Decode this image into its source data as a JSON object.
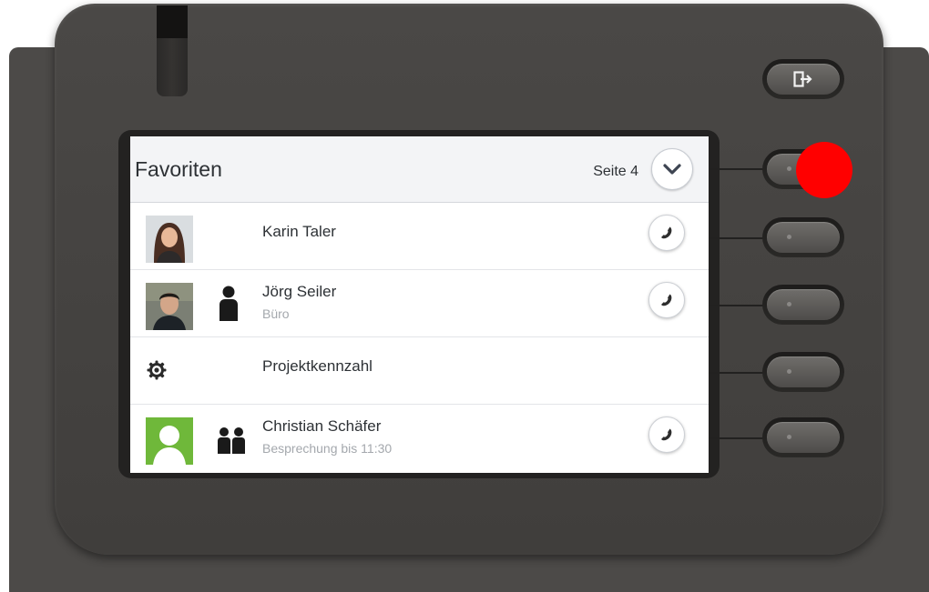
{
  "header": {
    "title": "Favoriten",
    "page_label": "Seite 4"
  },
  "contacts": [
    {
      "name": "Karin Taler",
      "subtitle": ""
    },
    {
      "name": "Jörg Seiler",
      "subtitle": "Büro"
    },
    {
      "name": "Projektkennzahl",
      "subtitle": ""
    },
    {
      "name": "Christian Schäfer",
      "subtitle": "Besprechung bis 11:30"
    }
  ],
  "colors": {
    "housing": "#4a4846",
    "screen_bg": "#ffffff",
    "header_bg": "#f3f4f6",
    "text": "#2d3135",
    "subtext": "#a4a8ad",
    "highlight_marker": "#ff0000",
    "avatar_generic": "#6fb83a"
  },
  "icons": {
    "exit": "exit-icon",
    "page_down": "chevron-down-icon",
    "call": "phone-handset-icon",
    "presence_single": "person-icon",
    "presence_group": "people-icon",
    "feature": "gear-icon"
  }
}
